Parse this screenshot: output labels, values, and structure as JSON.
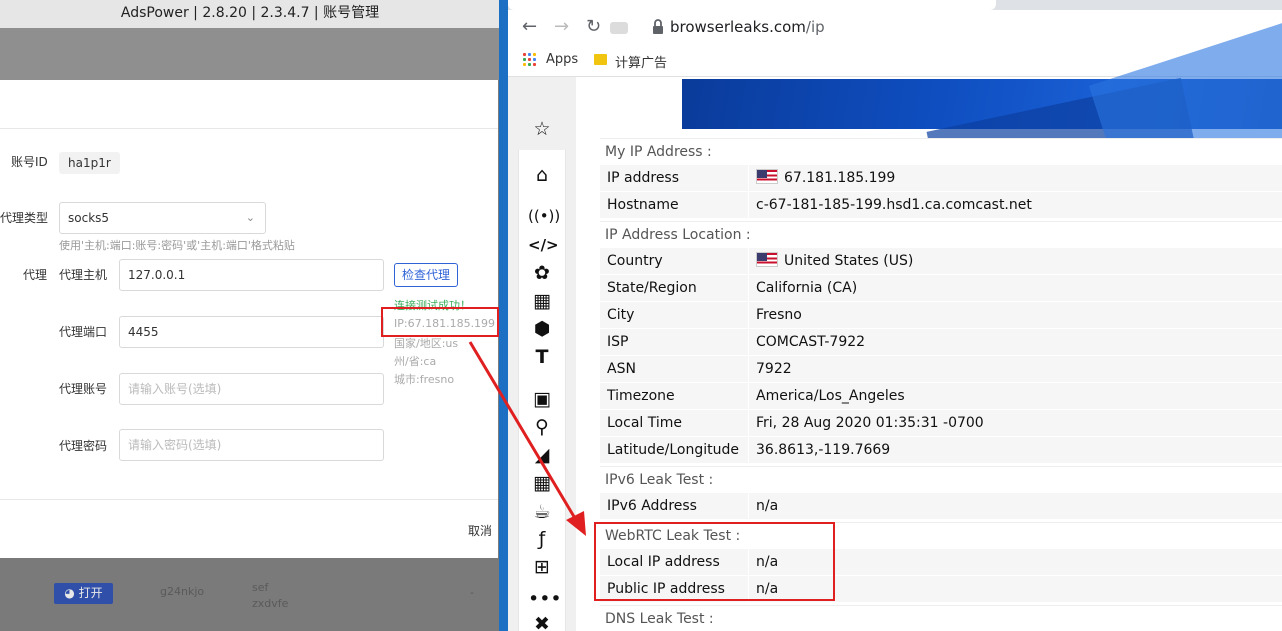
{
  "ads": {
    "title": "AdsPower | 2.8.20 | 2.3.4.7 | 账号管理",
    "form": {
      "account_id_label": "账号ID",
      "account_id_value": "ha1p1r",
      "proxy_type_label": "代理类型",
      "proxy_type_value": "socks5",
      "proxy_type_hint": "使用'主机:端口:账号:密码'或'主机:端口'格式粘贴",
      "proxy_label": "代理",
      "host_label": "代理主机",
      "host_value": "127.0.0.1",
      "port_label": "代理端口",
      "port_value": "4455",
      "user_label": "代理账号",
      "user_placeholder": "请输入账号(选填)",
      "pass_label": "代理密码",
      "pass_placeholder": "请输入密码(选填)",
      "check_button": "检查代理",
      "result_lines": [
        "连接测试成功！",
        "IP:67.181.185.199",
        "国家/地区:us",
        "州/省:ca",
        "城市:fresno"
      ],
      "cancel_button": "取消"
    },
    "background": {
      "open_button": "打开",
      "row_name": "g24nkjo",
      "row_col1": "sef",
      "row_col2": "zxdvfe",
      "dash": "-"
    }
  },
  "browser": {
    "url_domain": "browserleaks.com",
    "url_path": "/ip",
    "bookmarks": [
      "Apps",
      "计算广告"
    ]
  },
  "sidebar_icons": [
    "pin-icon",
    "home-icon",
    "radio-signal-icon",
    "code-icon",
    "flower-icon",
    "image-icon",
    "cube-icon",
    "text-height-icon",
    "lock-icon",
    "map-pin-icon",
    "stairs-icon",
    "firewall-icon",
    "java-cup-icon",
    "flash-icon",
    "windows-icon",
    "more-icon",
    "tools-icon"
  ],
  "sections": {
    "my_ip": "My IP Address :",
    "ip_location": "IP Address Location :",
    "ipv6": "IPv6 Leak Test :",
    "webrtc": "WebRTC Leak Test :",
    "dns": "DNS Leak Test :"
  },
  "rows": {
    "ip_address": {
      "k": "IP address",
      "v": "67.181.185.199"
    },
    "hostname": {
      "k": "Hostname",
      "v": "c-67-181-185-199.hsd1.ca.comcast.net"
    },
    "country": {
      "k": "Country",
      "v": "United States (US)"
    },
    "state": {
      "k": "State/Region",
      "v": "California (CA)"
    },
    "city": {
      "k": "City",
      "v": "Fresno"
    },
    "isp": {
      "k": "ISP",
      "v": "COMCAST-7922"
    },
    "asn": {
      "k": "ASN",
      "v": "7922"
    },
    "timezone": {
      "k": "Timezone",
      "v": "America/Los_Angeles"
    },
    "local_time": {
      "k": "Local Time",
      "v": "Fri, 28 Aug 2020 01:35:31 -0700"
    },
    "latlong": {
      "k": "Latitude/Longitude",
      "v": "36.8613,-119.7669"
    },
    "ipv6_address": {
      "k": "IPv6 Address",
      "v": "n/a"
    },
    "local_ip": {
      "k": "Local IP address",
      "v": "n/a"
    },
    "public_ip": {
      "k": "Public IP address",
      "v": "n/a"
    }
  },
  "colors": {
    "annotation_red": "#e02020",
    "divider_blue": "#1d6fc4",
    "adspower_primary": "#2f63d8"
  }
}
